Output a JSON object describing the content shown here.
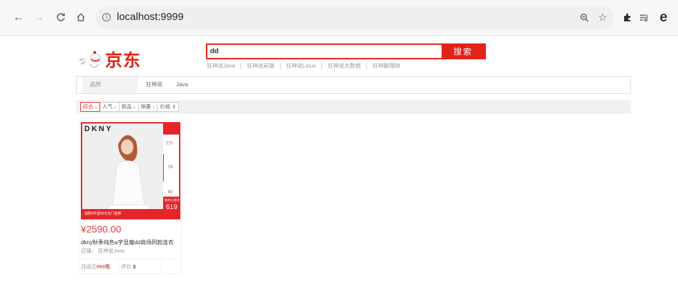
{
  "browser": {
    "url": "localhost:9999",
    "icons": [
      "back-icon",
      "forward-icon",
      "reload-icon",
      "home-icon",
      "info-icon",
      "zoom-icon",
      "star-icon",
      "extensions-icon",
      "reading-list-icon",
      "edge-icon"
    ]
  },
  "header": {
    "logo_text": "京东",
    "search_value": "dd",
    "search_button": "搜索",
    "hot_words": [
      "狂神说Java",
      "狂神说前端",
      "狂神说Linux",
      "狂神说大数据",
      "狂神聊理财"
    ]
  },
  "filter": {
    "label": "品牌",
    "values": [
      "狂神说",
      "Java"
    ]
  },
  "sort": {
    "items": [
      "综合",
      "人气",
      "新品",
      "销量",
      "价格"
    ]
  },
  "product": {
    "brand": "DKNY",
    "price": "¥2590.00",
    "name": "dkny秋季纯色a字显瘦dd商场同款连衣",
    "shop": "店铺： 狂神说Java",
    "sales_label": "月成交",
    "sales_value": "999笔",
    "reviews_label": "评价",
    "reviews_value": "3",
    "promo_text": "加购5件送50元无门槛券",
    "promo_price": "619",
    "promo_label": "到手价参考",
    "side_prices": [
      "777",
      "78",
      "80"
    ]
  },
  "colors": {
    "jd_red": "#e2231a",
    "price_red": "#e4393c"
  }
}
